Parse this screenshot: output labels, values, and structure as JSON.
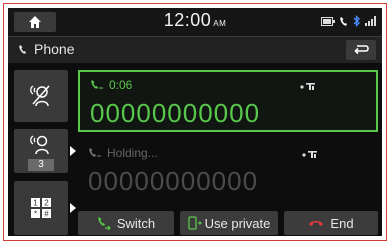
{
  "statusbar": {
    "time": "12:00",
    "ampm": "AM"
  },
  "titlebar": {
    "title": "Phone"
  },
  "side": {
    "conference_count": "3"
  },
  "active_call": {
    "duration": "0:06",
    "number": "00000000000"
  },
  "held_call": {
    "status": "Holding...",
    "number": "00000000000"
  },
  "actions": {
    "switch_label": "Switch",
    "private_label": "Use private",
    "end_label": "End"
  },
  "colors": {
    "accent_green": "#58c84a",
    "end_red": "#e03a3a",
    "background": "#0d0d0d"
  }
}
